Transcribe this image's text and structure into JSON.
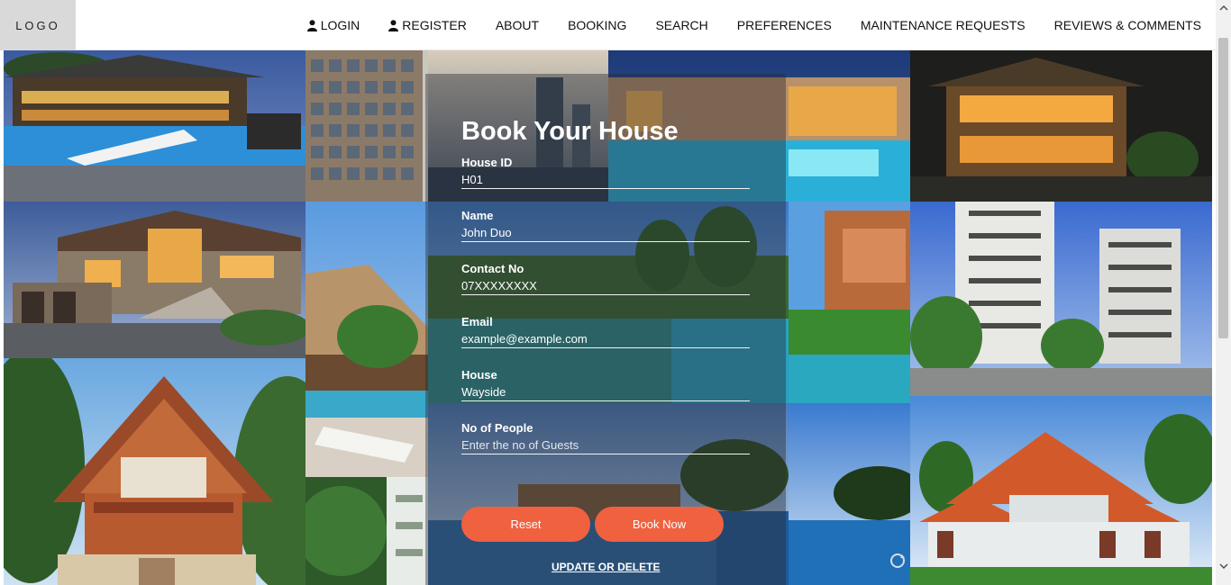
{
  "header": {
    "logo": "LOGO",
    "nav": [
      {
        "label": "LOGIN",
        "icon": "user-icon"
      },
      {
        "label": "REGISTER",
        "icon": "user-icon"
      },
      {
        "label": "ABOUT"
      },
      {
        "label": "BOOKING"
      },
      {
        "label": "SEARCH"
      },
      {
        "label": "PREFERENCES"
      },
      {
        "label": "MAINTENANCE REQUESTS"
      },
      {
        "label": "REVIEWS & COMMENTS"
      }
    ]
  },
  "form": {
    "title": "Book Your House",
    "fields": [
      {
        "label": "House ID",
        "value": "H01",
        "placeholder": ""
      },
      {
        "label": "Name",
        "value": "John Duo",
        "placeholder": ""
      },
      {
        "label": "Contact No",
        "value": "07XXXXXXXX",
        "placeholder": ""
      },
      {
        "label": "Email",
        "value": "example@example.com",
        "placeholder": ""
      },
      {
        "label": "House",
        "value": "Wayside",
        "placeholder": ""
      },
      {
        "label": "No of People",
        "value": "",
        "placeholder": "Enter the no of Guests"
      }
    ],
    "reset_label": "Reset",
    "book_label": "Book Now",
    "update_link": "UPDATE OR DELETE"
  },
  "colors": {
    "accent": "#f0613f",
    "overlay": "#282c34",
    "logo_bg": "#d9d9d9"
  }
}
